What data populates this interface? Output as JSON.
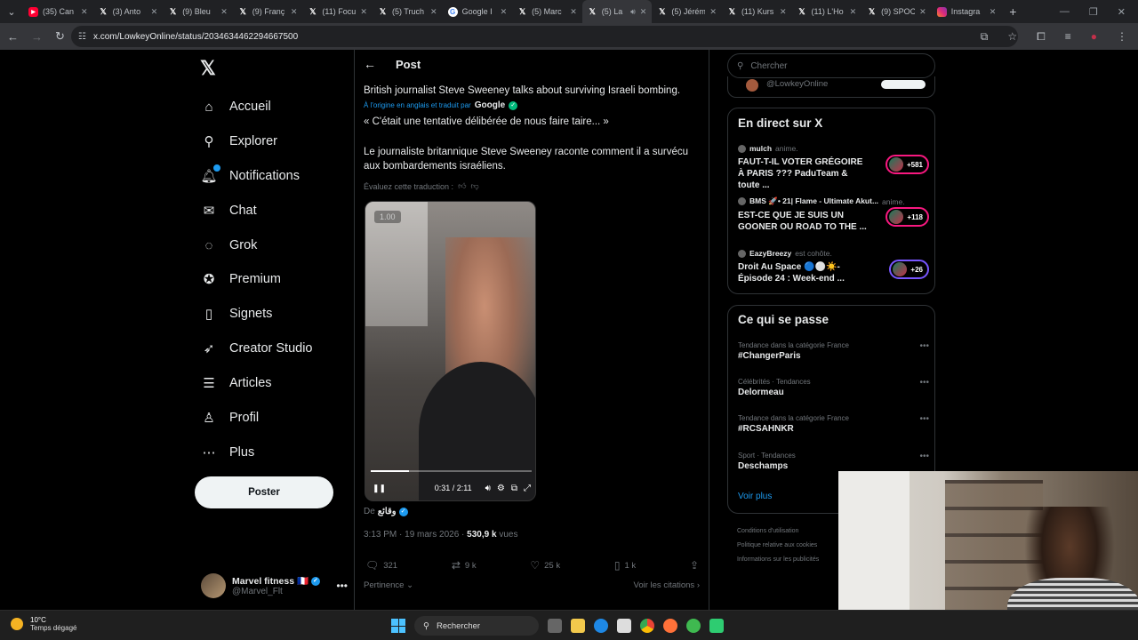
{
  "browser": {
    "tabs": [
      {
        "title": "(35) Can",
        "icon": "youtube"
      },
      {
        "title": "(3) Anto",
        "icon": "x"
      },
      {
        "title": "(9) Bleu",
        "icon": "x"
      },
      {
        "title": "(9) Franç",
        "icon": "x"
      },
      {
        "title": "(11) Focu",
        "icon": "x"
      },
      {
        "title": "(5) Truch",
        "icon": "x"
      },
      {
        "title": "Google I",
        "icon": "google"
      },
      {
        "title": "(5) Marc",
        "icon": "x"
      },
      {
        "title": "(5) La",
        "icon": "x",
        "active": true
      },
      {
        "title": "(5) Jérém",
        "icon": "x"
      },
      {
        "title": "(11) Kurs",
        "icon": "x"
      },
      {
        "title": "(11) L'Ho",
        "icon": "x"
      },
      {
        "title": "(9) SPOC",
        "icon": "x"
      },
      {
        "title": "Instagra",
        "icon": "instagram"
      }
    ],
    "url": "x.com/LowkeyOnline/status/2034634462294667500"
  },
  "nav": {
    "items": [
      {
        "label": "Accueil",
        "icon": "home-icon",
        "glyph": "⌂"
      },
      {
        "label": "Explorer",
        "icon": "search-icon",
        "glyph": "⚲"
      },
      {
        "label": "Notifications",
        "icon": "bell-icon",
        "glyph": "🔔︎"
      },
      {
        "label": "Chat",
        "icon": "mail-icon",
        "glyph": "✉"
      },
      {
        "label": "Grok",
        "icon": "grok-icon",
        "glyph": "◌"
      },
      {
        "label": "Premium",
        "icon": "premium-icon",
        "glyph": "✪"
      },
      {
        "label": "Signets",
        "icon": "bookmark-icon",
        "glyph": "▯"
      },
      {
        "label": "Creator Studio",
        "icon": "rocket-icon",
        "glyph": "➶"
      },
      {
        "label": "Articles",
        "icon": "articles-icon",
        "glyph": "☰"
      },
      {
        "label": "Profil",
        "icon": "person-icon",
        "glyph": "♙"
      },
      {
        "label": "Plus",
        "icon": "more-circle-icon",
        "glyph": "⋯"
      }
    ],
    "post_button": "Poster",
    "account": {
      "name": "Marvel fitness 🇫🇷",
      "handle": "@Marvel_Flt"
    }
  },
  "post": {
    "header": "Post",
    "text_en": "British journalist Steve Sweeney talks about surviving Israeli bombing.",
    "translated_label": "À l'origine en anglais et traduit par",
    "translated_by": "Google",
    "text_fr_quote": "« C'était une tentative délibérée de nous faire taire... »",
    "text_fr_body": "Le journaliste britannique Steve Sweeney raconte comment il a survécu aux bombardements israéliens.",
    "rate_label": "Évaluez cette traduction :",
    "video": {
      "rate": "1.00",
      "time": "0:31 / 2:11",
      "progress": 0.237
    },
    "from_label": "De",
    "from_name": "وقائع",
    "time": "3:13 PM · 19 mars 2026 · ",
    "views": "530,9 k",
    "views_label": " vues",
    "replies": "321",
    "reposts": "9 k",
    "likes": "25 k",
    "bookmarks": "1 k",
    "sort_label": "Pertinence",
    "quotes_label": "Voir les citations"
  },
  "sidebar": {
    "search_placeholder": "Chercher",
    "peek_handle": "@LowkeyOnline",
    "live_title": "En direct sur X",
    "live": [
      {
        "host": "mulch",
        "action": "anime.",
        "title": "FAUT-T-IL VOTER GRÉGOIRE À PARIS ??? PaduTeam & toute ...",
        "count": "+581"
      },
      {
        "host": "BMS 🚀• 21| Flame - Ultimate Akut...",
        "action": "anime.",
        "title": "EST-CE QUE JE SUIS UN GOONER OU ROAD TO THE ...",
        "count": "+118"
      },
      {
        "host": "EazyBreezy",
        "action": "est cohôte.",
        "title": "Droit Au Space 🔵⚪☀️- Épisode 24 : Week-end ...",
        "count": "+26"
      }
    ],
    "trends_title": "Ce qui se passe",
    "trends": [
      {
        "category": "Tendance dans la catégorie France",
        "name": "#ChangerParis"
      },
      {
        "category": "Célébrités · Tendances",
        "name": "Delormeau"
      },
      {
        "category": "Tendance dans la catégorie France",
        "name": "#RCSAHNKR"
      },
      {
        "category": "Sport · Tendances",
        "name": "Deschamps"
      }
    ],
    "see_more": "Voir plus",
    "footer": [
      "Conditions d'utilisation",
      "Politique relative aux cookies",
      "Informations sur les publicités"
    ]
  },
  "taskbar": {
    "temp": "10°C",
    "weather": "Temps dégagé",
    "search": "Rechercher"
  },
  "colors": {
    "accent": "#1d9bf0",
    "live_pink": "#f91880",
    "live_purple": "#7856ff"
  }
}
